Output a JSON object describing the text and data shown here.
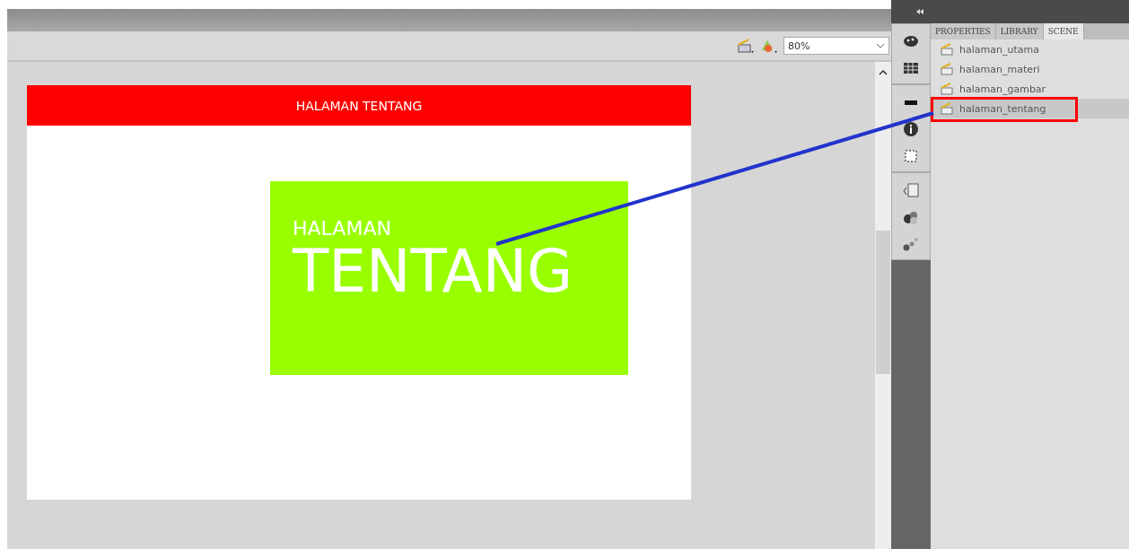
{
  "toolbar": {
    "zoom": "80%"
  },
  "stage": {
    "header": "HALAMAN TENTANG",
    "box_small": "HALAMAN",
    "box_large": "TENTANG"
  },
  "panel": {
    "tabs": [
      {
        "label": "PROPERTIES",
        "selected": false
      },
      {
        "label": "LIBRARY",
        "selected": false
      },
      {
        "label": "SCENE",
        "selected": true
      }
    ],
    "scenes": [
      {
        "name": "halaman_utama",
        "selected": false,
        "highlighted": false
      },
      {
        "name": "halaman_materi",
        "selected": false,
        "highlighted": false
      },
      {
        "name": "halaman_gambar",
        "selected": false,
        "highlighted": false
      },
      {
        "name": "halaman_tentang",
        "selected": true,
        "highlighted": true
      }
    ]
  }
}
